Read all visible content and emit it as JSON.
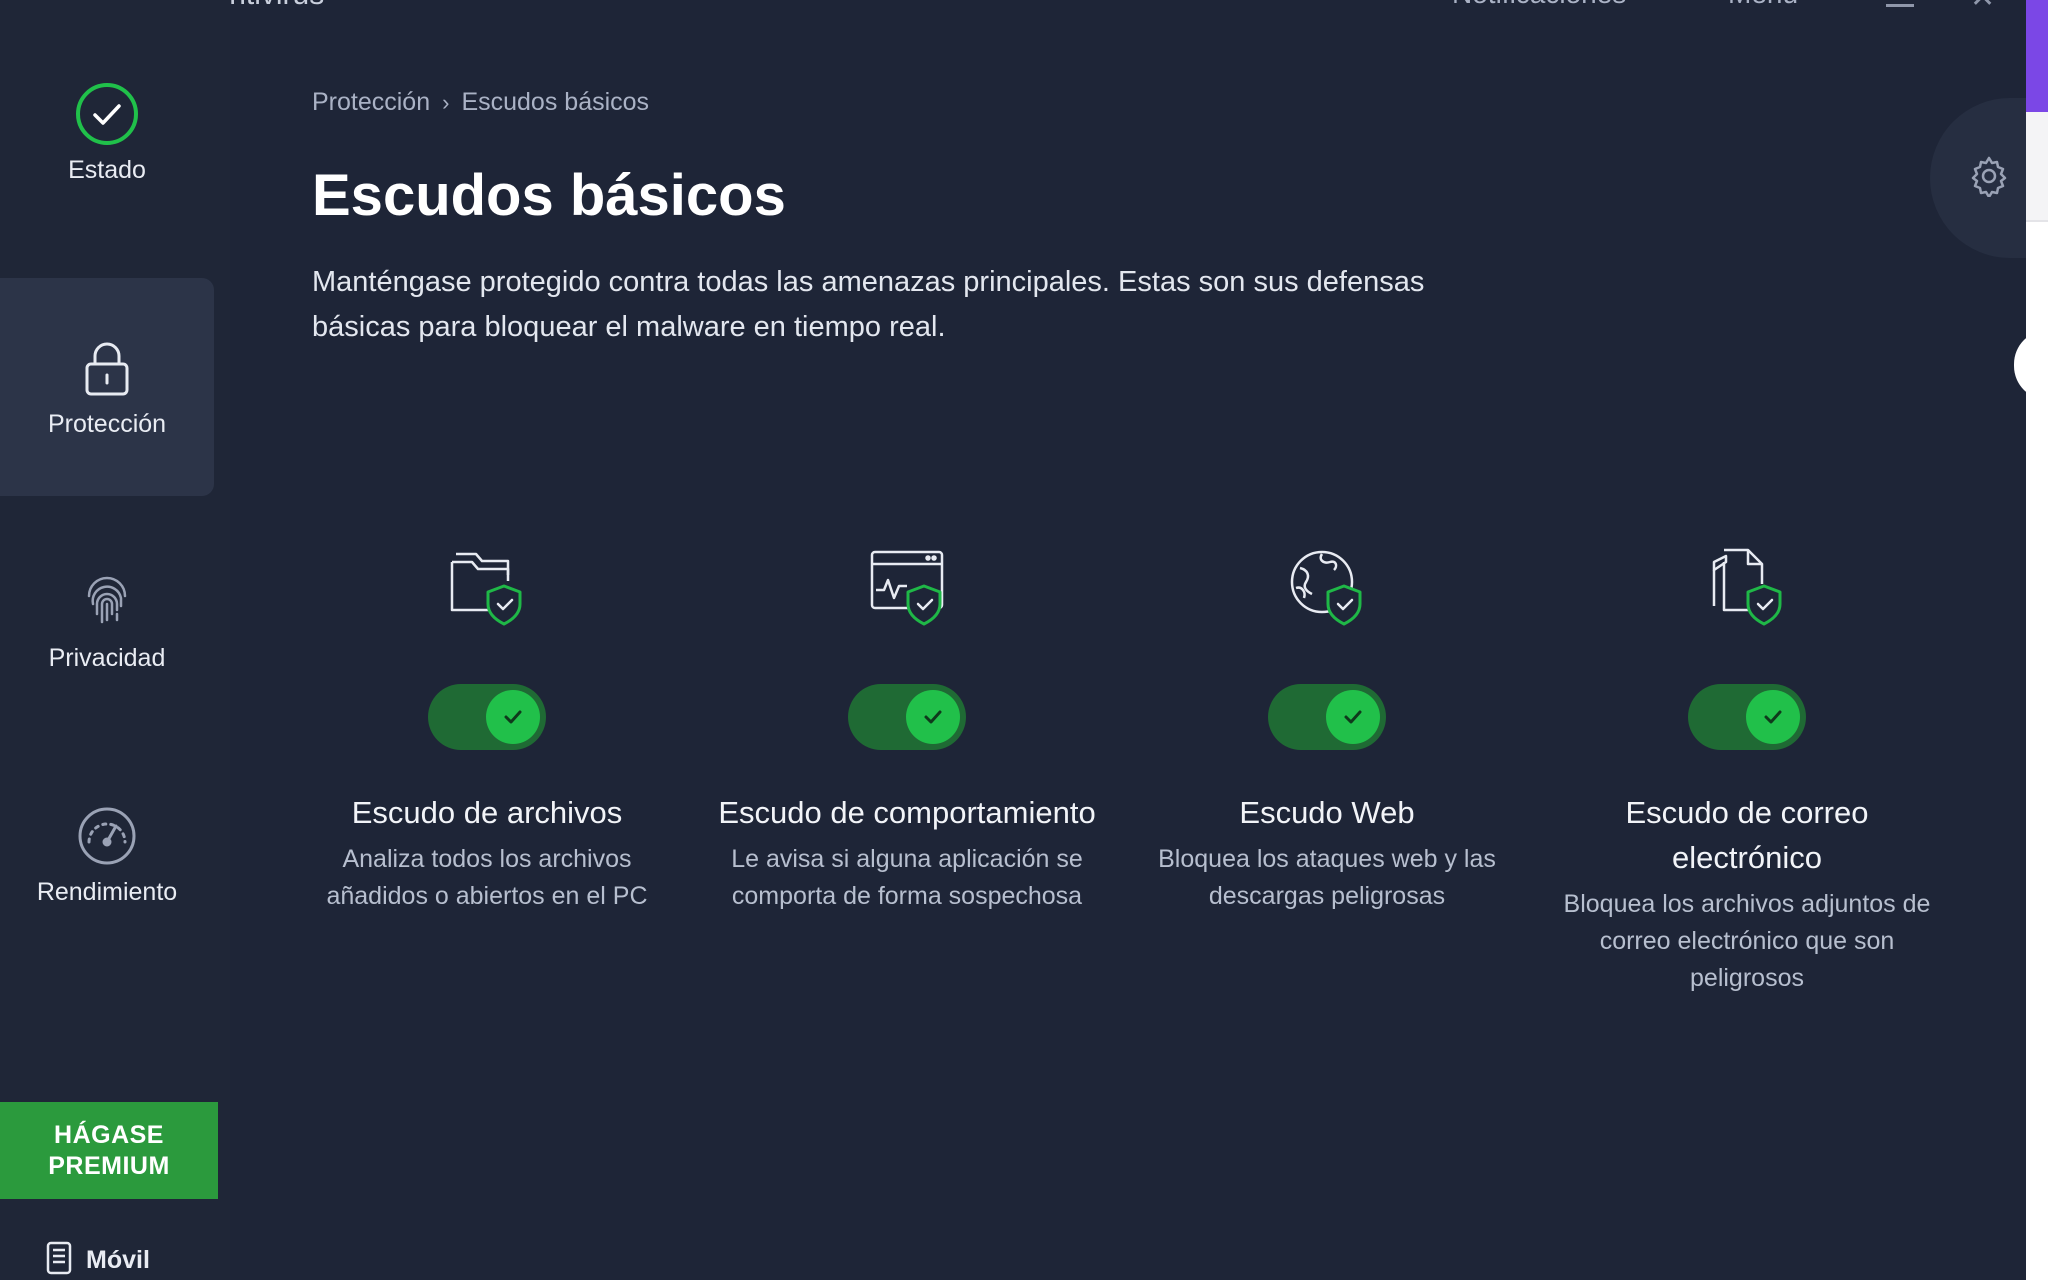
{
  "titlebar": {
    "app_title": "Avast Free Antivirus",
    "notifications_label": "Notificaciones",
    "menu_label": "Menú"
  },
  "sidebar": {
    "items": [
      {
        "label": "Estado",
        "icon": "check-circle-icon"
      },
      {
        "label": "Protección",
        "icon": "lock-icon"
      },
      {
        "label": "Privacidad",
        "icon": "fingerprint-icon"
      },
      {
        "label": "Rendimiento",
        "icon": "speedometer-icon"
      }
    ],
    "active_item": "Protección",
    "premium_line1": "HÁGASE",
    "premium_line2": "PREMIUM",
    "mobile_label": "Móvil"
  },
  "breadcrumb": {
    "parent": "Protección",
    "separator": "›",
    "current": "Escudos básicos"
  },
  "page": {
    "title": "Escudos básicos",
    "description": "Manténgase protegido contra todas las amenazas principales. Estas son sus defensas básicas para bloquear el malware en tiempo real."
  },
  "shields": [
    {
      "name": "Escudo de archivos",
      "description": "Analiza todos los archivos añadidos o abiertos en el PC",
      "icon": "folder-shield-icon",
      "enabled": true
    },
    {
      "name": "Escudo de comportamiento",
      "description": "Le avisa si alguna aplicación se comporta de forma sospechosa",
      "icon": "window-activity-shield-icon",
      "enabled": true
    },
    {
      "name": "Escudo Web",
      "description": "Bloquea los ataques web y las descargas peligrosas",
      "icon": "globe-shield-icon",
      "enabled": true
    },
    {
      "name": "Escudo de correo electrónico",
      "description": "Bloquea los archivos adjuntos de correo electrónico que son peligrosos",
      "icon": "document-shield-icon",
      "enabled": true
    }
  ],
  "colors": {
    "background": "#1e2537",
    "sidebar_active": "#2c3448",
    "premium_green": "#2b9a3d",
    "toggle_track": "#1f6a34",
    "toggle_knob": "#21c04a",
    "shield_accent": "#1fb847"
  }
}
